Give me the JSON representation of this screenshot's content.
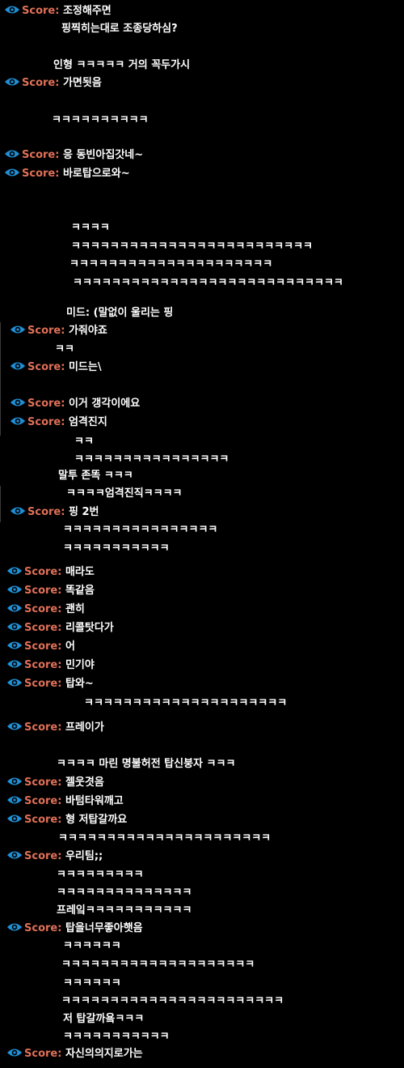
{
  "colors": {
    "background": "#000000",
    "tag": "#e07058",
    "eye_icon": "#1f8fd6",
    "text": "#ffffff"
  },
  "icon": "eye-icon",
  "tag": "Score:",
  "lines": [
    {
      "kind": "score",
      "text": "조정해주면"
    },
    {
      "kind": "plain",
      "text": "핑찍히는대로 조종당하심?"
    },
    {
      "kind": "plain",
      "text": "인형 ㅋㅋㅋㅋㅋ 거의 꼭두가시"
    },
    {
      "kind": "score",
      "text": "가면됫음"
    },
    {
      "kind": "plain",
      "text": "ㅋㅋㅋㅋㅋㅋㅋㅋㅋㅋ"
    },
    {
      "kind": "score",
      "text": "응 동빈아집갓네~"
    },
    {
      "kind": "score",
      "text": "바로탑으로와~"
    },
    {
      "kind": "plain",
      "text": "ㅋㅋㅋㅋ"
    },
    {
      "kind": "plain",
      "text": "ㅋㅋㅋㅋㅋㅋㅋㅋㅋㅋㅋㅋㅋㅋㅋㅋㅋㅋㅋㅋㅋㅋㅋㅋㅋ"
    },
    {
      "kind": "plain",
      "text": "ㅋㅋㅋㅋㅋㅋㅋㅋㅋㅋㅋㅋㅋㅋㅋㅋㅋㅋㅋㅋㅋ"
    },
    {
      "kind": "plain",
      "text": "ㅋㅋㅋㅋㅋㅋㅋㅋㅋㅋㅋㅋㅋㅋㅋㅋㅋㅋㅋㅋㅋㅋㅋㅋㅋㅋㅋㅋ"
    },
    {
      "kind": "plain",
      "text": "미드: (말없이 울리는 핑"
    },
    {
      "kind": "score",
      "text": "가줘야죠"
    },
    {
      "kind": "plain",
      "text": "ㅋㅋ"
    },
    {
      "kind": "score",
      "text": "미드는\\"
    },
    {
      "kind": "score",
      "text": "이거 갱각이에요"
    },
    {
      "kind": "score",
      "text": "엄격진지"
    },
    {
      "kind": "plain",
      "text": "ㅋㅋ"
    },
    {
      "kind": "plain",
      "text": "ㅋㅋㅋㅋㅋㅋㅋㅋㅋㅋㅋㅋㅋㅋㅋㅋ"
    },
    {
      "kind": "plain",
      "text": "말투 존똑 ㅋㅋㅋ"
    },
    {
      "kind": "plain",
      "text": "ㅋㅋㅋㅋ엄격진직ㅋㅋㅋㅋ"
    },
    {
      "kind": "score",
      "text": "핑 2번"
    },
    {
      "kind": "plain",
      "text": "ㅋㅋㅋㅋㅋㅋㅋㅋㅋㅋㅋㅋㅋㅋㅋㅋ"
    },
    {
      "kind": "plain",
      "text": "ㅋㅋㅋㅋㅋㅋㅋㅋㅋㅋㅋ"
    },
    {
      "kind": "score",
      "text": "매라도"
    },
    {
      "kind": "score",
      "text": "똑같음"
    },
    {
      "kind": "score",
      "text": "괜히"
    },
    {
      "kind": "score",
      "text": "리콜탓다가"
    },
    {
      "kind": "score",
      "text": "어"
    },
    {
      "kind": "score",
      "text": "민기야"
    },
    {
      "kind": "score",
      "text": "탑와~"
    },
    {
      "kind": "plain",
      "text": "ㅋㅋㅋㅋㅋㅋㅋㅋㅋㅋㅋㅋㅋㅋㅋㅋㅋㅋㅋㅋㅋ"
    },
    {
      "kind": "score",
      "text": "프레이가"
    },
    {
      "kind": "plain",
      "text": "ㅋㅋㅋㅋ 마린 명불허전 탑신붕자 ㅋㅋㅋ"
    },
    {
      "kind": "score",
      "text": "젤웃겻음"
    },
    {
      "kind": "score",
      "text": "바텀타워깨고"
    },
    {
      "kind": "score",
      "text": "형 저탑갈까요"
    },
    {
      "kind": "plain",
      "text": "ㅋㅋㅋㅋㅋㅋㅋㅋㅋㅋㅋㅋㅋㅋㅋㅋㅋㅋㅋㅋㅋㅋ"
    },
    {
      "kind": "score",
      "text": "우리팀;;"
    },
    {
      "kind": "plain",
      "text": "ㅋㅋㅋㅋㅋㅋㅋㅋㅋ"
    },
    {
      "kind": "plain",
      "text": "ㅋㅋㅋㅋㅋㅋㅋㅋㅋㅋㅋㅋㅋㅋ"
    },
    {
      "kind": "plain",
      "text": "프레잌ㅋㅋㅋㅋㅋㅋㅋㅋㅋㅋㅋ"
    },
    {
      "kind": "score",
      "text": "탑을너무좋아햇음"
    },
    {
      "kind": "plain",
      "text": "ㅋㅋㅋㅋㅋㅋ"
    },
    {
      "kind": "plain",
      "text": "ㅋㅋㅋㅋㅋㅋㅋㅋㅋㅋㅋㅋㅋㅋㅋㅋㅋㅋㅋㅋ"
    },
    {
      "kind": "plain",
      "text": "ㅋㅋㅋㅋㅋㅋ"
    },
    {
      "kind": "plain",
      "text": "ㅋㅋㅋㅋㅋㅋㅋㅋㅋㅋㅋㅋㅋㅋㅋㅋㅋㅋㅋㅋㅋㅋㅋ"
    },
    {
      "kind": "plain",
      "text": "저 탑갈까욬ㅋㅋㅋ"
    },
    {
      "kind": "plain",
      "text": "ㅋㅋㅋㅋㅋㅋㅋㅋㅋㅋㅋ"
    },
    {
      "kind": "score",
      "text": "자신의의지로가는"
    }
  ]
}
